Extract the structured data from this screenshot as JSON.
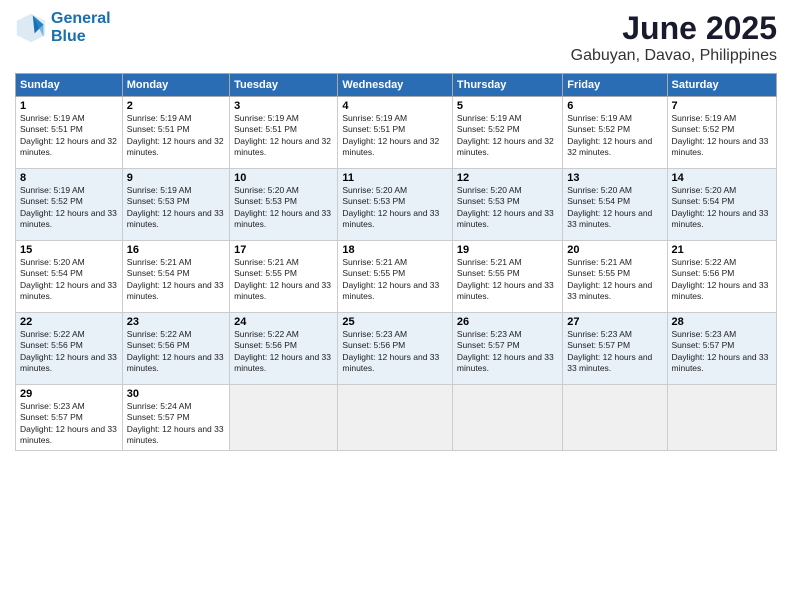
{
  "logo": {
    "line1": "General",
    "line2": "Blue"
  },
  "title": "June 2025",
  "subtitle": "Gabuyan, Davao, Philippines",
  "days_of_week": [
    "Sunday",
    "Monday",
    "Tuesday",
    "Wednesday",
    "Thursday",
    "Friday",
    "Saturday"
  ],
  "weeks": [
    [
      {
        "day": "1",
        "sunrise": "Sunrise: 5:19 AM",
        "sunset": "Sunset: 5:51 PM",
        "daylight": "Daylight: 12 hours and 32 minutes."
      },
      {
        "day": "2",
        "sunrise": "Sunrise: 5:19 AM",
        "sunset": "Sunset: 5:51 PM",
        "daylight": "Daylight: 12 hours and 32 minutes."
      },
      {
        "day": "3",
        "sunrise": "Sunrise: 5:19 AM",
        "sunset": "Sunset: 5:51 PM",
        "daylight": "Daylight: 12 hours and 32 minutes."
      },
      {
        "day": "4",
        "sunrise": "Sunrise: 5:19 AM",
        "sunset": "Sunset: 5:51 PM",
        "daylight": "Daylight: 12 hours and 32 minutes."
      },
      {
        "day": "5",
        "sunrise": "Sunrise: 5:19 AM",
        "sunset": "Sunset: 5:52 PM",
        "daylight": "Daylight: 12 hours and 32 minutes."
      },
      {
        "day": "6",
        "sunrise": "Sunrise: 5:19 AM",
        "sunset": "Sunset: 5:52 PM",
        "daylight": "Daylight: 12 hours and 32 minutes."
      },
      {
        "day": "7",
        "sunrise": "Sunrise: 5:19 AM",
        "sunset": "Sunset: 5:52 PM",
        "daylight": "Daylight: 12 hours and 33 minutes."
      }
    ],
    [
      {
        "day": "8",
        "sunrise": "Sunrise: 5:19 AM",
        "sunset": "Sunset: 5:52 PM",
        "daylight": "Daylight: 12 hours and 33 minutes."
      },
      {
        "day": "9",
        "sunrise": "Sunrise: 5:19 AM",
        "sunset": "Sunset: 5:53 PM",
        "daylight": "Daylight: 12 hours and 33 minutes."
      },
      {
        "day": "10",
        "sunrise": "Sunrise: 5:20 AM",
        "sunset": "Sunset: 5:53 PM",
        "daylight": "Daylight: 12 hours and 33 minutes."
      },
      {
        "day": "11",
        "sunrise": "Sunrise: 5:20 AM",
        "sunset": "Sunset: 5:53 PM",
        "daylight": "Daylight: 12 hours and 33 minutes."
      },
      {
        "day": "12",
        "sunrise": "Sunrise: 5:20 AM",
        "sunset": "Sunset: 5:53 PM",
        "daylight": "Daylight: 12 hours and 33 minutes."
      },
      {
        "day": "13",
        "sunrise": "Sunrise: 5:20 AM",
        "sunset": "Sunset: 5:54 PM",
        "daylight": "Daylight: 12 hours and 33 minutes."
      },
      {
        "day": "14",
        "sunrise": "Sunrise: 5:20 AM",
        "sunset": "Sunset: 5:54 PM",
        "daylight": "Daylight: 12 hours and 33 minutes."
      }
    ],
    [
      {
        "day": "15",
        "sunrise": "Sunrise: 5:20 AM",
        "sunset": "Sunset: 5:54 PM",
        "daylight": "Daylight: 12 hours and 33 minutes."
      },
      {
        "day": "16",
        "sunrise": "Sunrise: 5:21 AM",
        "sunset": "Sunset: 5:54 PM",
        "daylight": "Daylight: 12 hours and 33 minutes."
      },
      {
        "day": "17",
        "sunrise": "Sunrise: 5:21 AM",
        "sunset": "Sunset: 5:55 PM",
        "daylight": "Daylight: 12 hours and 33 minutes."
      },
      {
        "day": "18",
        "sunrise": "Sunrise: 5:21 AM",
        "sunset": "Sunset: 5:55 PM",
        "daylight": "Daylight: 12 hours and 33 minutes."
      },
      {
        "day": "19",
        "sunrise": "Sunrise: 5:21 AM",
        "sunset": "Sunset: 5:55 PM",
        "daylight": "Daylight: 12 hours and 33 minutes."
      },
      {
        "day": "20",
        "sunrise": "Sunrise: 5:21 AM",
        "sunset": "Sunset: 5:55 PM",
        "daylight": "Daylight: 12 hours and 33 minutes."
      },
      {
        "day": "21",
        "sunrise": "Sunrise: 5:22 AM",
        "sunset": "Sunset: 5:56 PM",
        "daylight": "Daylight: 12 hours and 33 minutes."
      }
    ],
    [
      {
        "day": "22",
        "sunrise": "Sunrise: 5:22 AM",
        "sunset": "Sunset: 5:56 PM",
        "daylight": "Daylight: 12 hours and 33 minutes."
      },
      {
        "day": "23",
        "sunrise": "Sunrise: 5:22 AM",
        "sunset": "Sunset: 5:56 PM",
        "daylight": "Daylight: 12 hours and 33 minutes."
      },
      {
        "day": "24",
        "sunrise": "Sunrise: 5:22 AM",
        "sunset": "Sunset: 5:56 PM",
        "daylight": "Daylight: 12 hours and 33 minutes."
      },
      {
        "day": "25",
        "sunrise": "Sunrise: 5:23 AM",
        "sunset": "Sunset: 5:56 PM",
        "daylight": "Daylight: 12 hours and 33 minutes."
      },
      {
        "day": "26",
        "sunrise": "Sunrise: 5:23 AM",
        "sunset": "Sunset: 5:57 PM",
        "daylight": "Daylight: 12 hours and 33 minutes."
      },
      {
        "day": "27",
        "sunrise": "Sunrise: 5:23 AM",
        "sunset": "Sunset: 5:57 PM",
        "daylight": "Daylight: 12 hours and 33 minutes."
      },
      {
        "day": "28",
        "sunrise": "Sunrise: 5:23 AM",
        "sunset": "Sunset: 5:57 PM",
        "daylight": "Daylight: 12 hours and 33 minutes."
      }
    ],
    [
      {
        "day": "29",
        "sunrise": "Sunrise: 5:23 AM",
        "sunset": "Sunset: 5:57 PM",
        "daylight": "Daylight: 12 hours and 33 minutes."
      },
      {
        "day": "30",
        "sunrise": "Sunrise: 5:24 AM",
        "sunset": "Sunset: 5:57 PM",
        "daylight": "Daylight: 12 hours and 33 minutes."
      },
      null,
      null,
      null,
      null,
      null
    ]
  ]
}
